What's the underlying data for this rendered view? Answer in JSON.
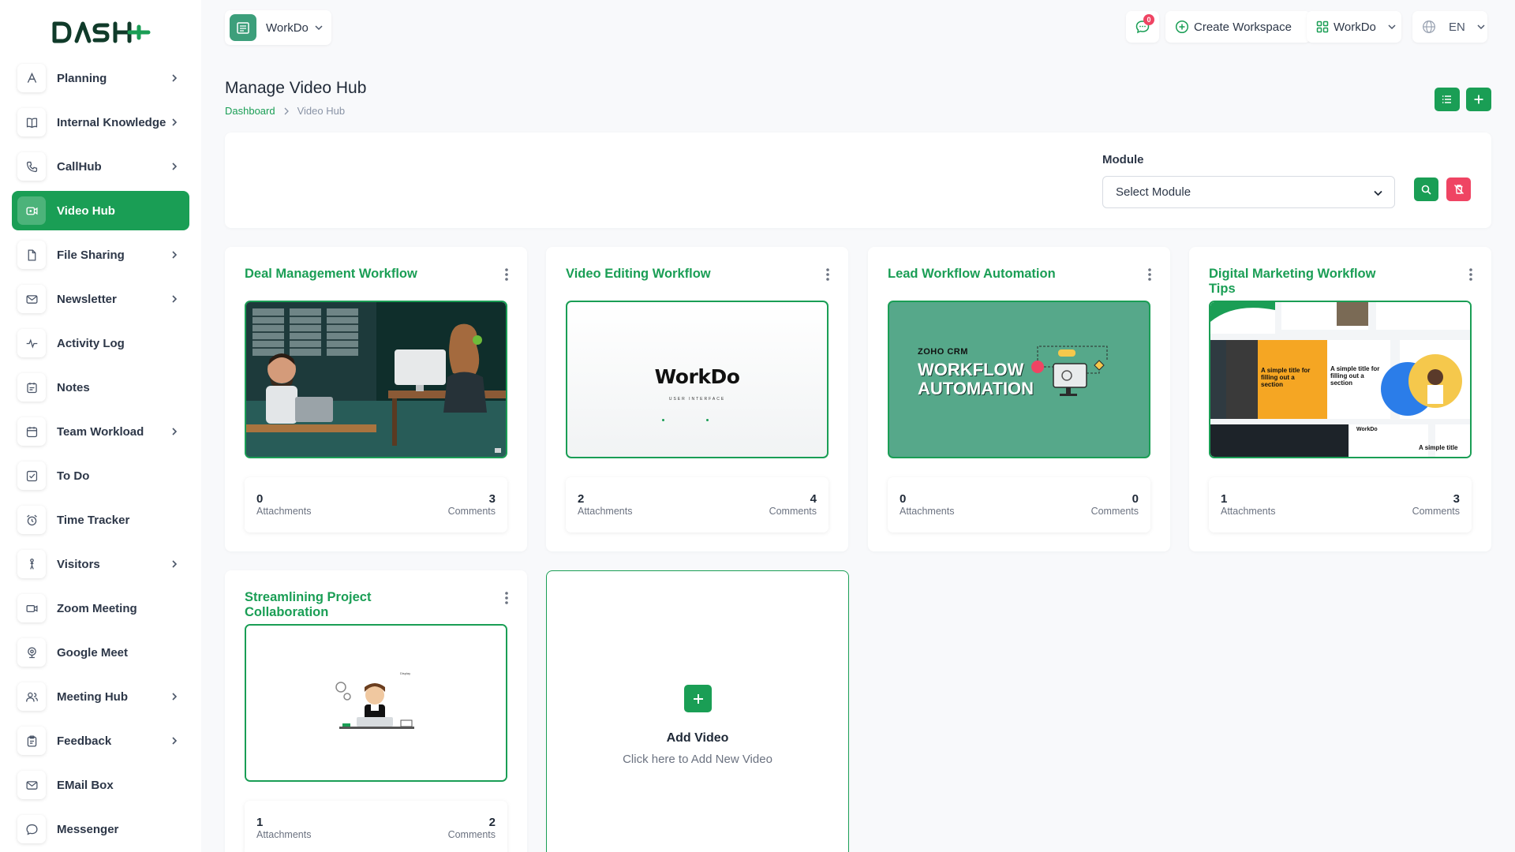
{
  "brand": {
    "logo_text": "DASH"
  },
  "sidebar": {
    "items": [
      {
        "label": "Planning",
        "icon": "planning-icon",
        "chevron": true,
        "active": false
      },
      {
        "label": "Internal Knowledge",
        "icon": "book-icon",
        "chevron": true,
        "active": false
      },
      {
        "label": "CallHub",
        "icon": "phone-icon",
        "chevron": true,
        "active": false
      },
      {
        "label": "Video Hub",
        "icon": "video-icon",
        "chevron": false,
        "active": true
      },
      {
        "label": "File Sharing",
        "icon": "file-icon",
        "chevron": true,
        "active": false
      },
      {
        "label": "Newsletter",
        "icon": "mail-icon",
        "chevron": true,
        "active": false
      },
      {
        "label": "Activity Log",
        "icon": "activity-icon",
        "chevron": false,
        "active": false
      },
      {
        "label": "Notes",
        "icon": "notes-icon",
        "chevron": false,
        "active": false
      },
      {
        "label": "Team Workload",
        "icon": "calendar-icon",
        "chevron": true,
        "active": false
      },
      {
        "label": "To Do",
        "icon": "checkbox-icon",
        "chevron": false,
        "active": false
      },
      {
        "label": "Time Tracker",
        "icon": "alarm-icon",
        "chevron": false,
        "active": false
      },
      {
        "label": "Visitors",
        "icon": "visitor-icon",
        "chevron": true,
        "active": false
      },
      {
        "label": "Zoom Meeting",
        "icon": "camera-icon",
        "chevron": false,
        "active": false
      },
      {
        "label": "Google Meet",
        "icon": "webcam-icon",
        "chevron": false,
        "active": false
      },
      {
        "label": "Meeting Hub",
        "icon": "users-icon",
        "chevron": true,
        "active": false
      },
      {
        "label": "Feedback",
        "icon": "clipboard-icon",
        "chevron": true,
        "active": false
      },
      {
        "label": "EMail Box",
        "icon": "envelope-icon",
        "chevron": false,
        "active": false
      },
      {
        "label": "Messenger",
        "icon": "chat-icon",
        "chevron": false,
        "active": false
      }
    ]
  },
  "header": {
    "workspace_name": "WorkDo",
    "message_count": "0",
    "create_workspace_label": "Create Workspace",
    "org_label": "WorkDo",
    "language_label": "EN"
  },
  "page": {
    "title": "Manage Video Hub",
    "breadcrumb": [
      "Dashboard",
      "Video Hub"
    ]
  },
  "filter": {
    "module_label": "Module",
    "module_selected": "Select Module"
  },
  "videos": [
    {
      "title": "Deal Management Workflow",
      "attachments": "0",
      "attachments_label": "Attachments",
      "comments": "3",
      "comments_label": "Comments"
    },
    {
      "title": "Video Editing Workflow",
      "attachments": "2",
      "attachments_label": "Attachments",
      "comments": "4",
      "comments_label": "Comments",
      "thumb_text": "WorkDo",
      "thumb_sub": "USER INTERFACE"
    },
    {
      "title": "Lead Workflow Automation",
      "attachments": "0",
      "attachments_label": "Attachments",
      "comments": "0",
      "comments_label": "Comments",
      "thumb_kicker": "ZOHO CRM",
      "thumb_line1": "WORKFLOW",
      "thumb_line2": "AUTOMATION"
    },
    {
      "title": "Digital Marketing Workflow Tips",
      "attachments": "1",
      "attachments_label": "Attachments",
      "comments": "3",
      "comments_label": "Comments",
      "thumb_caption1": "A simple title for filling out a section",
      "thumb_caption2": "A simple title for filling out a section",
      "thumb_brand": "WorkDo",
      "thumb_caption3": "A simple title"
    },
    {
      "title": "Streamlining Project Collaboration",
      "attachments": "1",
      "attachments_label": "Attachments",
      "comments": "2",
      "comments_label": "Comments"
    }
  ],
  "add_video": {
    "title": "Add Video",
    "subtitle": "Click here to Add New Video"
  },
  "colors": {
    "primary": "#1a9e55",
    "danger": "#ef4463",
    "background": "#f8f9fb"
  }
}
